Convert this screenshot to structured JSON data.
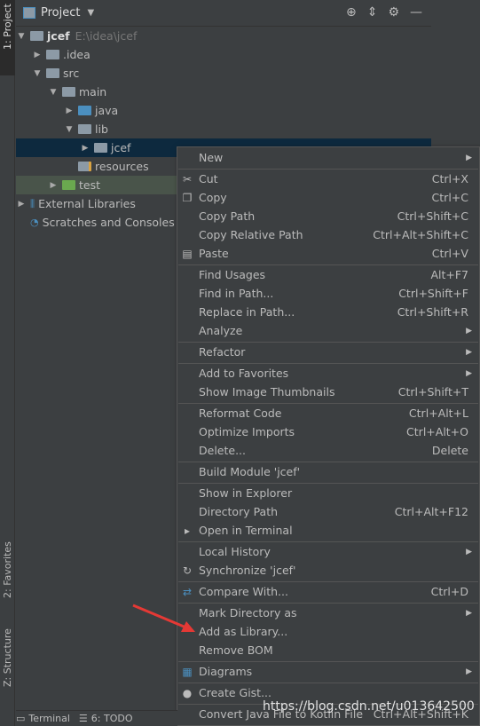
{
  "left_strip": {
    "project_tab": "1: Project",
    "favorites_tab": "2: Favorites",
    "structure_tab": "Z: Structure"
  },
  "header": {
    "title": "Project"
  },
  "tree": {
    "root_name": "jcef",
    "root_path": "E:\\idea\\jcef",
    "items": [
      "jcef",
      ".idea",
      "src",
      "main",
      "java",
      "lib",
      "jcef",
      "resources",
      "test",
      "External Libraries",
      "Scratches and Consoles"
    ]
  },
  "menu": {
    "new": "New",
    "cut": "Cut",
    "cut_sc": "Ctrl+X",
    "copy": "Copy",
    "copy_sc": "Ctrl+C",
    "copy_path": "Copy Path",
    "copy_path_sc": "Ctrl+Shift+C",
    "copy_rel": "Copy Relative Path",
    "copy_rel_sc": "Ctrl+Alt+Shift+C",
    "paste": "Paste",
    "paste_sc": "Ctrl+V",
    "find_usages": "Find Usages",
    "find_usages_sc": "Alt+F7",
    "find_in_path": "Find in Path...",
    "find_in_path_sc": "Ctrl+Shift+F",
    "replace_in_path": "Replace in Path...",
    "replace_in_path_sc": "Ctrl+Shift+R",
    "analyze": "Analyze",
    "refactor": "Refactor",
    "add_fav": "Add to Favorites",
    "show_thumbs": "Show Image Thumbnails",
    "show_thumbs_sc": "Ctrl+Shift+T",
    "reformat": "Reformat Code",
    "reformat_sc": "Ctrl+Alt+L",
    "optimize": "Optimize Imports",
    "optimize_sc": "Ctrl+Alt+O",
    "delete": "Delete...",
    "delete_sc": "Delete",
    "build_module": "Build Module 'jcef'",
    "show_explorer": "Show in Explorer",
    "dir_path": "Directory Path",
    "dir_path_sc": "Ctrl+Alt+F12",
    "open_terminal": "Open in Terminal",
    "local_history": "Local History",
    "synchronize": "Synchronize 'jcef'",
    "compare": "Compare With...",
    "compare_sc": "Ctrl+D",
    "mark_dir": "Mark Directory as",
    "add_library": "Add as Library...",
    "remove_bom": "Remove BOM",
    "diagrams": "Diagrams",
    "create_gist": "Create Gist...",
    "convert": "Convert Java File to Kotlin File",
    "convert_sc": "Ctrl+Alt+Shift+K"
  },
  "bottom_bar": {
    "terminal": "Terminal",
    "todo": "6: TODO"
  },
  "watermark": "https://blog.csdn.net/u013642500",
  "colors": {
    "selection": "#0d293e",
    "test_row": "#49544a",
    "arrow": "#e53935"
  }
}
